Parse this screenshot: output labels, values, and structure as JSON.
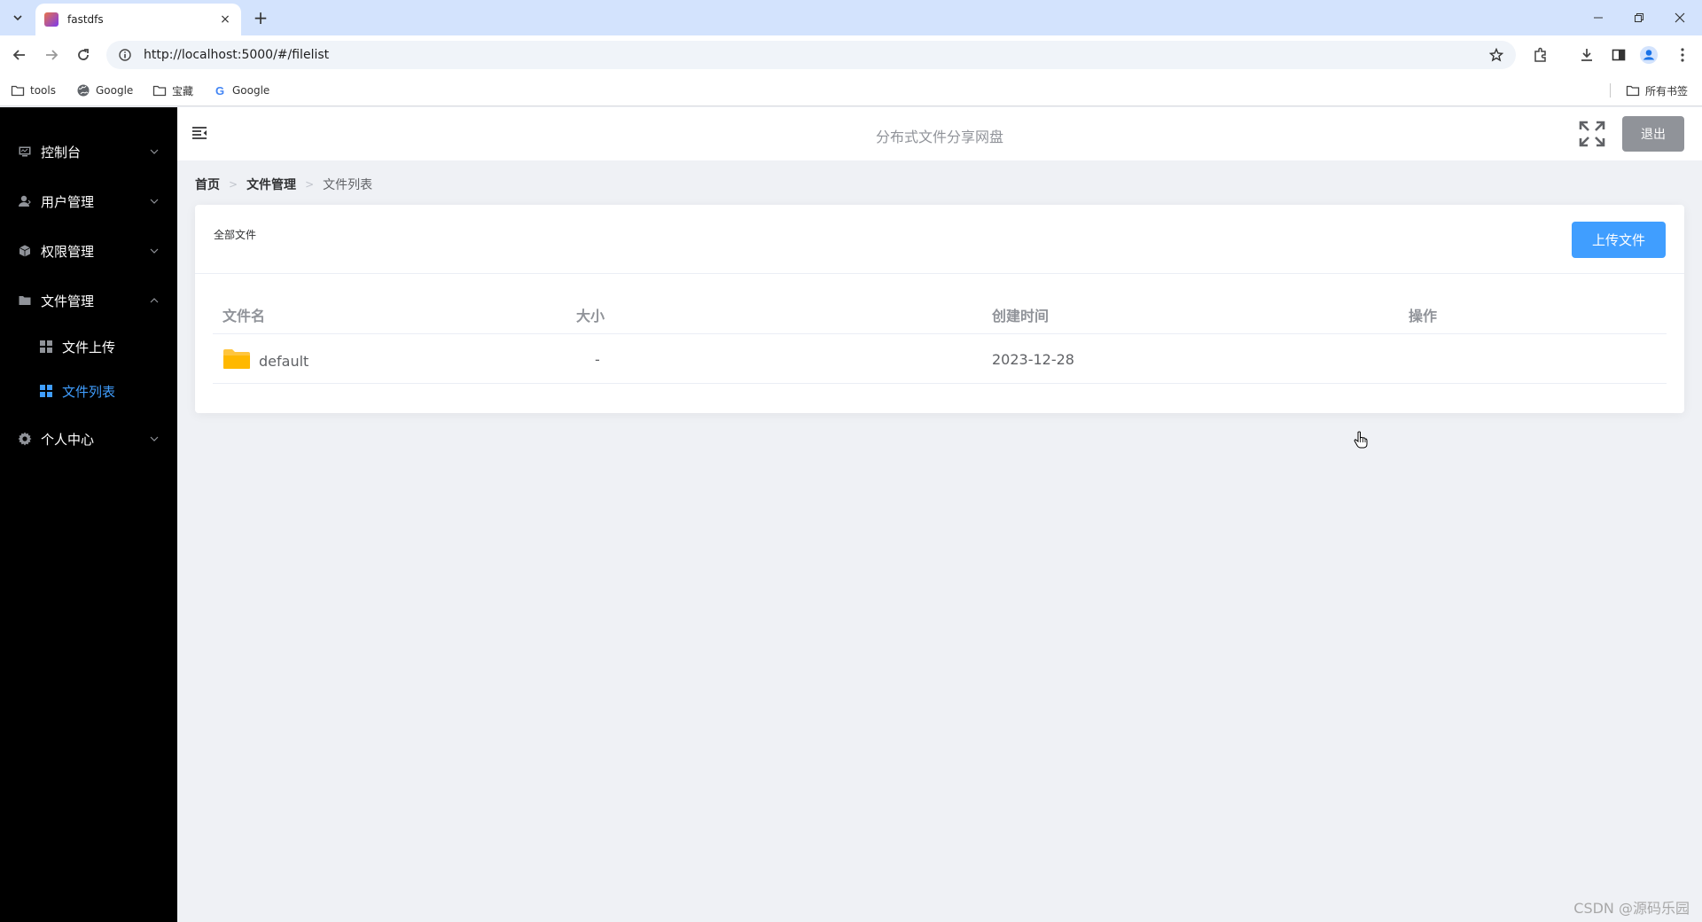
{
  "browser": {
    "tab_title": "fastdfs",
    "tab_close": "×",
    "new_tab": "+",
    "url": "http://localhost:5000/#/filelist",
    "bookmarks": [
      {
        "label": "tools",
        "icon": "folder-icon"
      },
      {
        "label": "Google",
        "icon": "globe-icon"
      },
      {
        "label": "宝藏",
        "icon": "folder-icon"
      },
      {
        "label": "Google",
        "icon": "google-icon"
      }
    ],
    "all_bookmarks": "所有书签"
  },
  "sidebar": {
    "items": [
      {
        "label": "控制台",
        "icon": "monitor-icon",
        "expanded": false
      },
      {
        "label": "用户管理",
        "icon": "user-icon",
        "expanded": false
      },
      {
        "label": "权限管理",
        "icon": "cube-icon",
        "expanded": false
      },
      {
        "label": "文件管理",
        "icon": "folder-icon",
        "expanded": true,
        "children": [
          {
            "label": "文件上传",
            "icon": "grid-icon",
            "active": false
          },
          {
            "label": "文件列表",
            "icon": "grid-icon",
            "active": true
          }
        ]
      },
      {
        "label": "个人中心",
        "icon": "gear-icon",
        "expanded": false
      }
    ]
  },
  "header": {
    "title": "分布式文件分享网盘",
    "logout_label": "退出"
  },
  "breadcrumb": [
    "首页",
    "文件管理",
    "文件列表"
  ],
  "card": {
    "title": "全部文件",
    "upload_label": "上传文件"
  },
  "table": {
    "columns": [
      "文件名",
      "大小",
      "创建时间",
      "操作"
    ],
    "rows": [
      {
        "name": "default",
        "size": "-",
        "created": "2023-12-28",
        "icon": "folder-icon"
      }
    ]
  },
  "watermark": "CSDN @源码乐园",
  "colors": {
    "accent": "#409eff",
    "sidebar_bg": "#000000",
    "logout_bg": "#909399",
    "folder": "#ffc53d"
  }
}
